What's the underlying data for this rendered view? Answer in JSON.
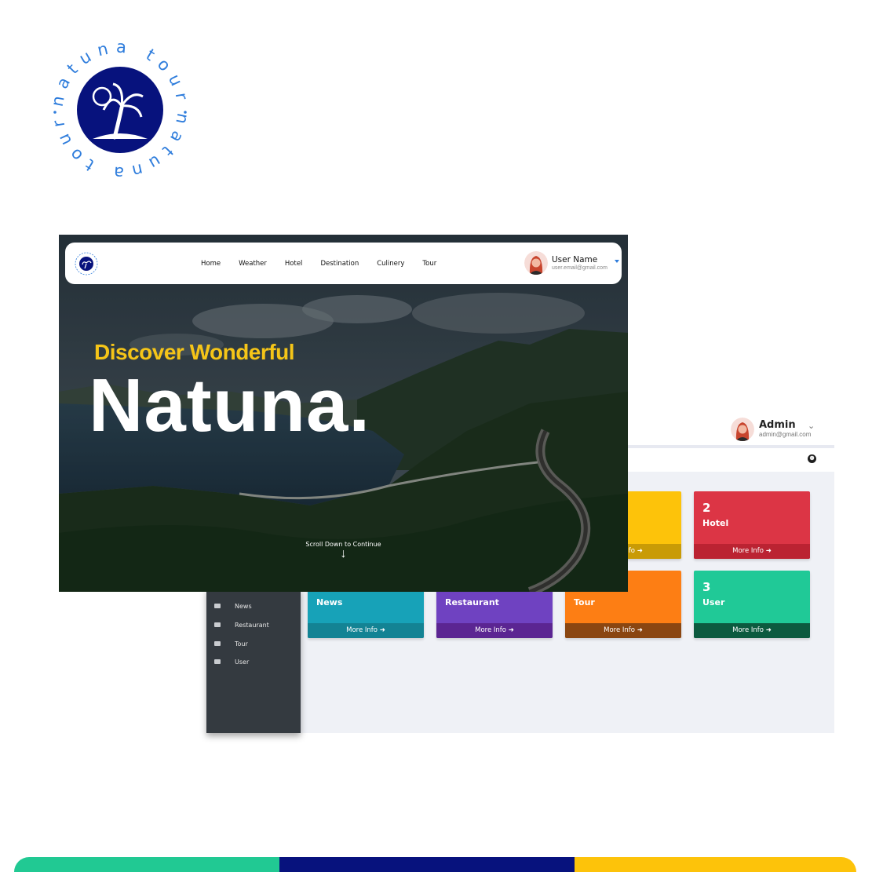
{
  "brand": {
    "ring_text": "natuna tour",
    "colors": {
      "navy": "#07127d",
      "blue": "#2f7ddc",
      "yellow": "#fdc30a",
      "teal": "#21c993"
    }
  },
  "landing": {
    "nav": {
      "links": [
        "Home",
        "Weather",
        "Hotel",
        "Destination",
        "Culinery",
        "Tour"
      ],
      "user_name": "User Name",
      "user_email": "user.email@gmail.com"
    },
    "hero": {
      "subtitle": "Discover Wonderful",
      "title": "Natuna.",
      "scroll_text": "Scroll Down to Continue",
      "scroll_icon": "arrow-down-icon"
    }
  },
  "admin": {
    "user_name": "Admin",
    "user_email": "admin@gmail.com",
    "sidebar": [
      {
        "label": "News",
        "icon": "newspaper-icon"
      },
      {
        "label": "Restaurant",
        "icon": "utensils-icon"
      },
      {
        "label": "Tour",
        "icon": "suitcase-icon"
      },
      {
        "label": "User",
        "icon": "users-icon"
      }
    ],
    "cards": [
      {
        "count": "",
        "label": "",
        "more": "More Info",
        "color": "#fdc30a",
        "footer": "#c99b06"
      },
      {
        "count": "2",
        "label": "Hotel",
        "more": "More Info",
        "color": "#dc3545",
        "footer": "#bb2332"
      },
      {
        "count": "",
        "label": "News",
        "more": "More Info",
        "color": "#17a2b8",
        "footer": "#138394"
      },
      {
        "count": "",
        "label": "Restaurant",
        "more": "More Info",
        "color": "#6f42c1",
        "footer": "#5b2592"
      },
      {
        "count": "",
        "label": "Tour",
        "more": "More Info",
        "color": "#fd7e14",
        "footer": "#8a4611"
      },
      {
        "count": "3",
        "label": "User",
        "more": "More Info",
        "color": "#20c997",
        "footer": "#0c5a3f"
      }
    ]
  },
  "stripe_colors": [
    "#21c993",
    "#07127d",
    "#fdc30a"
  ]
}
